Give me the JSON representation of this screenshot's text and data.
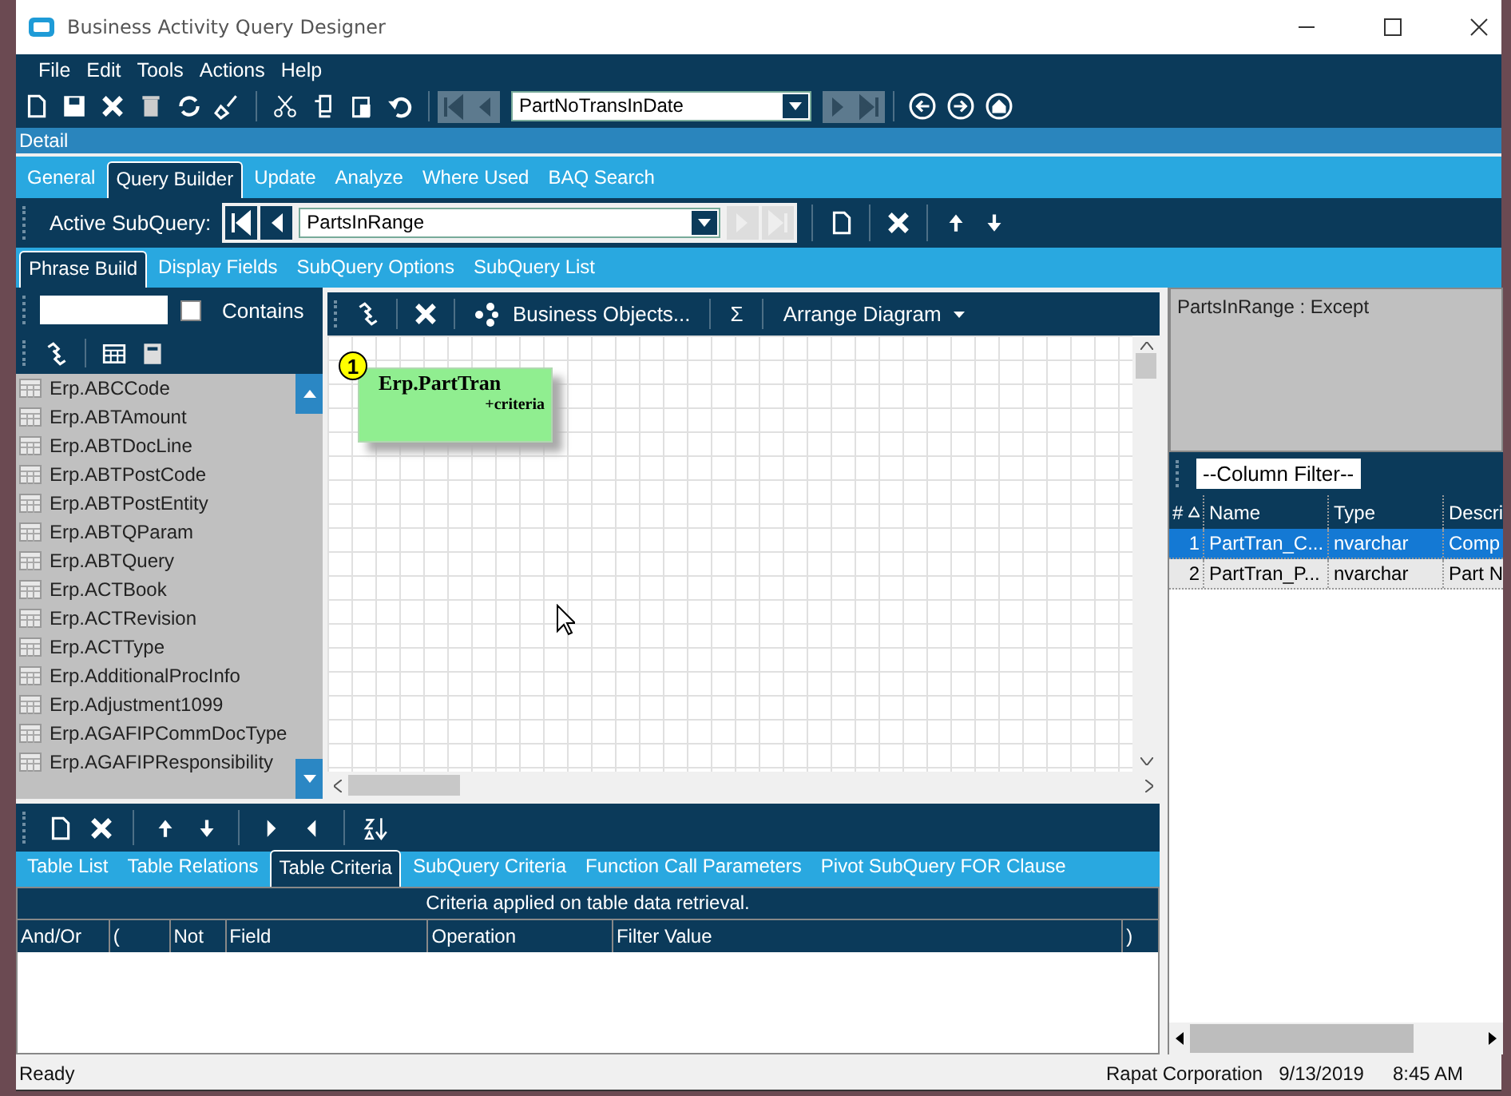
{
  "window": {
    "title": "Business Activity Query Designer"
  },
  "menu": [
    "File",
    "Edit",
    "Tools",
    "Actions",
    "Help"
  ],
  "toolbar": {
    "query_id": "PartNoTransInDate"
  },
  "detail_label": "Detail",
  "tabs": [
    {
      "label": "General",
      "selected": false
    },
    {
      "label": "Query Builder",
      "selected": true
    },
    {
      "label": "Update",
      "selected": false
    },
    {
      "label": "Analyze",
      "selected": false
    },
    {
      "label": "Where Used",
      "selected": false
    },
    {
      "label": "BAQ Search",
      "selected": false
    }
  ],
  "subquery": {
    "label": "Active SubQuery:",
    "value": "PartsInRange"
  },
  "phrase_tabs": [
    {
      "label": "Phrase Build",
      "selected": true
    },
    {
      "label": "Display Fields",
      "selected": false
    },
    {
      "label": "SubQuery Options",
      "selected": false
    },
    {
      "label": "SubQuery List",
      "selected": false
    }
  ],
  "table_search": {
    "contains_label": "Contains",
    "checked": false
  },
  "tables": [
    "Erp.ABCCode",
    "Erp.ABTAmount",
    "Erp.ABTDocLine",
    "Erp.ABTPostCode",
    "Erp.ABTPostEntity",
    "Erp.ABTQParam",
    "Erp.ABTQuery",
    "Erp.ACTBook",
    "Erp.ACTRevision",
    "Erp.ACTType",
    "Erp.AdditionalProcInfo",
    "Erp.Adjustment1099",
    "Erp.AGAFIPCommDocType",
    "Erp.AGAFIPResponsibility"
  ],
  "diagram_toolbar": {
    "business_objects": "Business Objects...",
    "sum": "Σ",
    "arrange": "Arrange Diagram"
  },
  "diagram_node": {
    "number": "1",
    "title": "Erp.PartTran",
    "subtitle": "+criteria"
  },
  "subquery_info": "PartsInRange : Except",
  "column_filter": "--Column Filter--",
  "display_fields": {
    "columns": [
      "#",
      "Name",
      "Type",
      "Descri"
    ],
    "rows": [
      {
        "num": "1",
        "name": "PartTran_C...",
        "type": "nvarchar",
        "description": "Comp",
        "selected": true
      },
      {
        "num": "2",
        "name": "PartTran_P...",
        "type": "nvarchar",
        "description": "Part N",
        "selected": false
      }
    ]
  },
  "bottom_tabs": [
    {
      "label": "Table List",
      "selected": false
    },
    {
      "label": "Table Relations",
      "selected": false
    },
    {
      "label": "Table Criteria",
      "selected": true
    },
    {
      "label": "SubQuery Criteria",
      "selected": false
    },
    {
      "label": "Function Call Parameters",
      "selected": false
    },
    {
      "label": "Pivot SubQuery FOR Clause",
      "selected": false
    }
  ],
  "criteria": {
    "caption": "Criteria applied on  table data retrieval.",
    "columns": [
      "And/Or",
      "(",
      "Not",
      "Field",
      "Operation",
      "Filter Value",
      ")"
    ]
  },
  "status_bar": {
    "status": "Ready",
    "company": "Rapat Corporation",
    "date": "9/13/2019",
    "time": "8:45 AM"
  }
}
